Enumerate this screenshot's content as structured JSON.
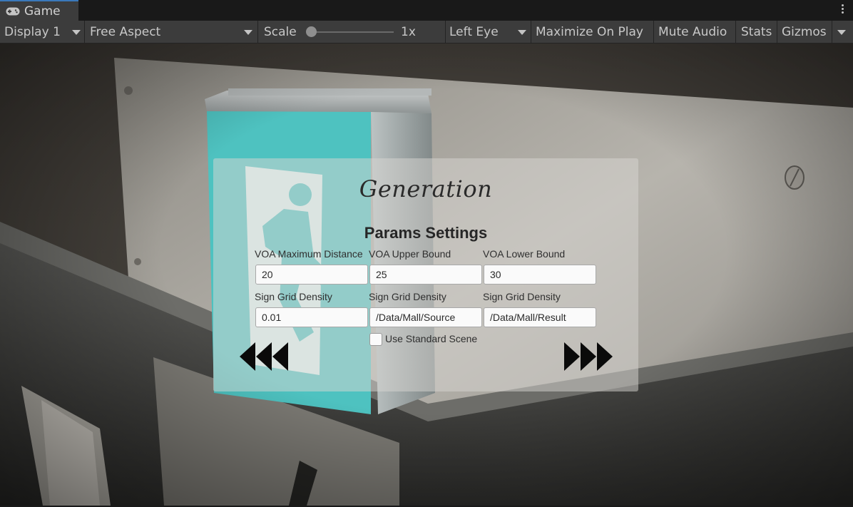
{
  "window": {
    "tab_label": "Game"
  },
  "toolbar": {
    "display": "Display 1",
    "aspect": "Free Aspect",
    "scale_label": "Scale",
    "scale_value": "1x",
    "eye": "Left Eye",
    "maximize": "Maximize On Play",
    "mute": "Mute Audio",
    "stats": "Stats",
    "gizmos": "Gizmos"
  },
  "panel": {
    "title": "Generation",
    "subtitle": "Params Settings",
    "fields": [
      {
        "label": "VOA Maximum Distance",
        "value": "20"
      },
      {
        "label": "VOA Upper Bound",
        "value": "25"
      },
      {
        "label": "VOA Lower Bound",
        "value": "30"
      },
      {
        "label": "Sign Grid Density",
        "value": "0.01"
      },
      {
        "label": "Sign Grid Density",
        "value": "/Data/Mall/Source"
      },
      {
        "label": "Sign Grid Density",
        "value": "/Data/Mall/Result"
      }
    ],
    "checkbox": {
      "label": "Use Standard Scene",
      "checked": false
    }
  },
  "icons": {
    "tab": "gamepad-icon",
    "menu": "kebab-menu-icon",
    "prev": "rewind-arrows-icon",
    "next": "fast-forward-arrows-icon"
  },
  "colors": {
    "tab_accent": "#3a79bb",
    "toolbar_bg": "#3c3c3c",
    "sign_green": "#49c3c0"
  }
}
